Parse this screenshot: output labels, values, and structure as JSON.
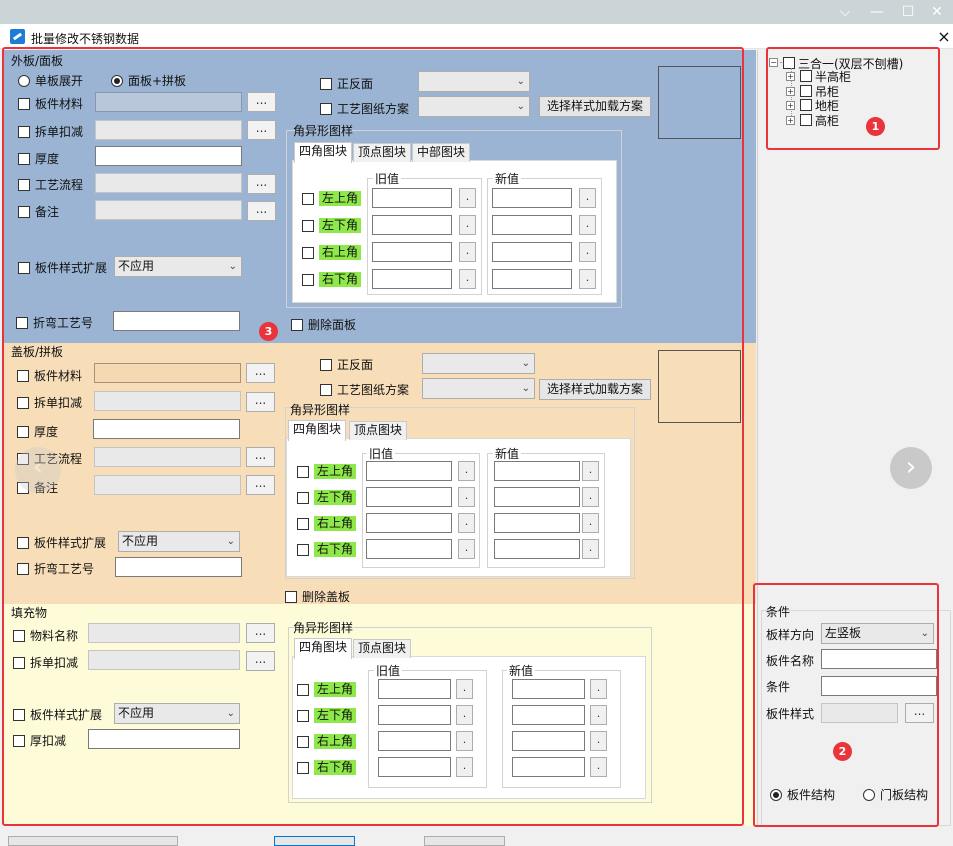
{
  "window": {
    "title": "批量修改不锈钢数据",
    "close_icon": "×",
    "min_icon": "⌵",
    "minimize": "—",
    "maximize": "☐",
    "close": "✕"
  },
  "outer": {
    "title": "外板/面板",
    "radio_single": "单板展开",
    "radio_panel": "面板+拼板",
    "material": "板件材料",
    "deduct": "拆单扣减",
    "thickness": "厚度",
    "process": "工艺流程",
    "note": "备注",
    "style_ext": "板件样式扩展",
    "style_ext_value": "不应用",
    "bend_no": "折弯工艺号",
    "front_back": "正反面",
    "drawing_scheme": "工艺图纸方案",
    "load_scheme_btn": "选择样式加载方案",
    "shape_group": "角异形图样",
    "tabs": [
      "四角图块",
      "顶点图块",
      "中部图块"
    ],
    "old_value": "旧值",
    "new_value": "新值",
    "corners": [
      "左上角",
      "左下角",
      "右上角",
      "右下角"
    ],
    "delete_label": "删除面板",
    "dots": "...",
    "dot": "."
  },
  "cover": {
    "title": "盖板/拼板",
    "material": "板件材料",
    "deduct": "拆单扣减",
    "thickness": "厚度",
    "process": "工艺流程",
    "note": "备注",
    "style_ext": "板件样式扩展",
    "style_ext_value": "不应用",
    "bend_no": "折弯工艺号",
    "front_back": "正反面",
    "drawing_scheme": "工艺图纸方案",
    "load_scheme_btn": "选择样式加载方案",
    "shape_group": "角异形图样",
    "tabs": [
      "四角图块",
      "顶点图块"
    ],
    "old_value": "旧值",
    "new_value": "新值",
    "corners": [
      "左上角",
      "左下角",
      "右上角",
      "右下角"
    ],
    "delete_label": "删除盖板"
  },
  "fill": {
    "title": "填充物",
    "material_name": "物料名称",
    "deduct": "拆单扣减",
    "style_ext": "板件样式扩展",
    "style_ext_value": "不应用",
    "thick_deduct": "厚扣减",
    "shape_group": "角异形图样",
    "tabs": [
      "四角图块",
      "顶点图块"
    ],
    "old_value": "旧值",
    "new_value": "新值",
    "corners": [
      "左上角",
      "左下角",
      "右上角",
      "右下角"
    ]
  },
  "tree": {
    "root": "三合一(双层不刨槽)",
    "children": [
      "半高柜",
      "吊柜",
      "地柜",
      "高柜"
    ],
    "expand": "+",
    "collapse": "−"
  },
  "conditions": {
    "title": "条件",
    "direction_label": "板样方向",
    "direction_value": "左竖板",
    "name_label": "板件名称",
    "cond_label": "条件",
    "style_label": "板件样式",
    "radio_board": "板件结构",
    "radio_door": "门板结构"
  },
  "badges": [
    "1",
    "2",
    "3"
  ],
  "nav": {
    "next_arrow": "›",
    "prev_arrow": "‹",
    "dropdown_arrow": "⌄"
  },
  "colors": {
    "outer_bg": "#9bb4d3",
    "cover_bg": "#f7deb9",
    "fill_bg": "#fdfbd8",
    "highlight_red": "#e8343a",
    "corner_green": "#8ee84a"
  }
}
